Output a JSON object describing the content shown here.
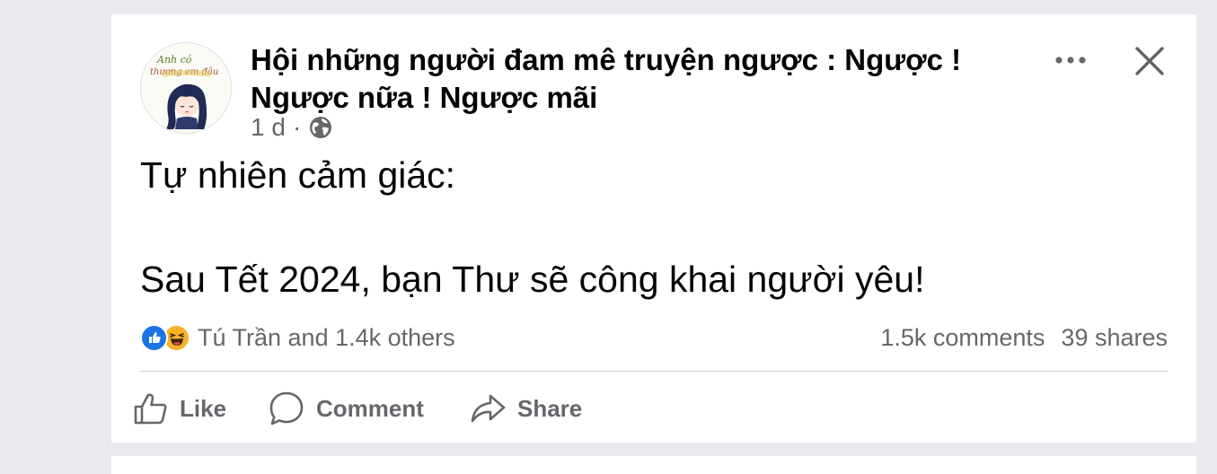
{
  "post": {
    "group_name": "Hội những người đam mê truyện ngược : Ngược ! Ngược nữa ! Ngược mãi",
    "time": "1 d",
    "separator": "·",
    "privacy_icon": "globe-icon",
    "avatar_caption_line1": "Anh có",
    "avatar_caption_line2": "thương em đâu",
    "text_lines": [
      "Tự nhiên cảm giác:",
      "Sau Tết 2024, bạn Thư sẽ công khai người yêu!"
    ],
    "more_icon": "more-options-icon",
    "close_icon": "close-icon"
  },
  "reactions": {
    "icons": [
      "like-reaction-icon",
      "haha-reaction-icon"
    ],
    "summary": "Tú Trần and 1.4k others"
  },
  "stats": {
    "comments": "1.5k comments",
    "shares": "39 shares"
  },
  "actions": {
    "like": "Like",
    "comment": "Comment",
    "share": "Share"
  },
  "colors": {
    "background": "#e9eaee",
    "card": "#ffffff",
    "text_primary": "#050505",
    "text_secondary": "#65676b",
    "like_blue": "#1b74e4",
    "haha_yellow": "#f7b125"
  }
}
